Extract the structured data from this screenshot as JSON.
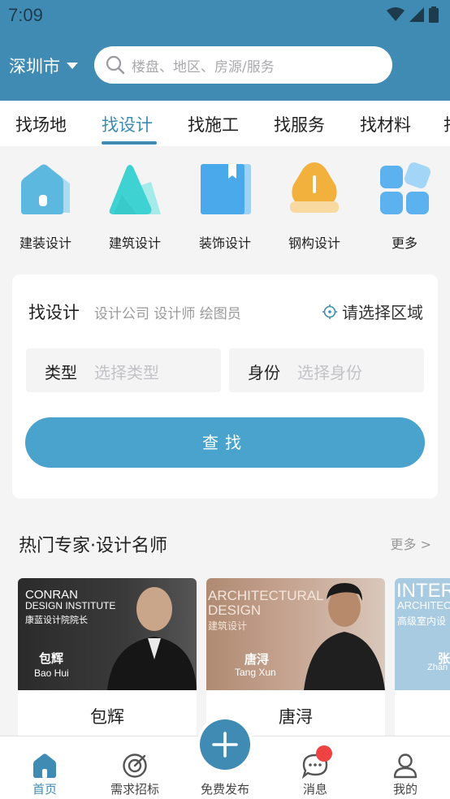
{
  "status": {
    "time": "7:09"
  },
  "header": {
    "city": "深圳市",
    "search_placeholder": "楼盘、地区、房源/服务"
  },
  "tabs": [
    {
      "label": "找场地"
    },
    {
      "label": "找设计"
    },
    {
      "label": "找施工"
    },
    {
      "label": "找服务"
    },
    {
      "label": "找材料"
    }
  ],
  "categories": [
    {
      "label": "建装设计",
      "icon": "house-icon",
      "color": "#5cb8df"
    },
    {
      "label": "建筑设计",
      "icon": "triangle-icon",
      "color": "#3fd2d2"
    },
    {
      "label": "装饰设计",
      "icon": "book-icon",
      "color": "#4aa9ea"
    },
    {
      "label": "钢构设计",
      "icon": "lamp-icon",
      "color": "#f2b13d"
    },
    {
      "label": "更多",
      "icon": "grid-icon",
      "color": "#5bb2ee"
    }
  ],
  "find_card": {
    "title": "找设计",
    "subtitle": "设计公司 设计师 绘图员",
    "region": "请选择区域",
    "type_label": "类型",
    "type_placeholder": "选择类型",
    "identity_label": "身份",
    "identity_placeholder": "选择身份",
    "search_button": "查找"
  },
  "experts_section": {
    "title": "热门专家·设计名师",
    "more": "更多 >",
    "experts": [
      {
        "name": "包辉",
        "photo_lines": [
          "CONRAN",
          "DESIGN INSTITUTE",
          "康蓝设计院院长"
        ],
        "photo_name": "包辉",
        "photo_pinyin": "Bao Hui"
      },
      {
        "name": "唐浔",
        "photo_lines": [
          "ARCHITECTURAL",
          "DESIGN",
          "建筑设计"
        ],
        "photo_name": "唐浔",
        "photo_pinyin": "Tang Xun"
      },
      {
        "name": "",
        "photo_lines": [
          "INTER",
          "ARCHITEC",
          "高级室内设"
        ],
        "photo_name": "张",
        "photo_pinyin": "Zhan"
      }
    ]
  },
  "bottom_nav": [
    {
      "label": "首页",
      "icon": "home-icon"
    },
    {
      "label": "需求招标",
      "icon": "target-icon"
    },
    {
      "label": "免费发布",
      "icon": "plus-icon"
    },
    {
      "label": "消息",
      "icon": "chat-icon"
    },
    {
      "label": "我的",
      "icon": "user-icon"
    }
  ],
  "colors": {
    "brand": "#3f8bb3",
    "button": "#4aa3cd",
    "badge": "#ef4343"
  }
}
